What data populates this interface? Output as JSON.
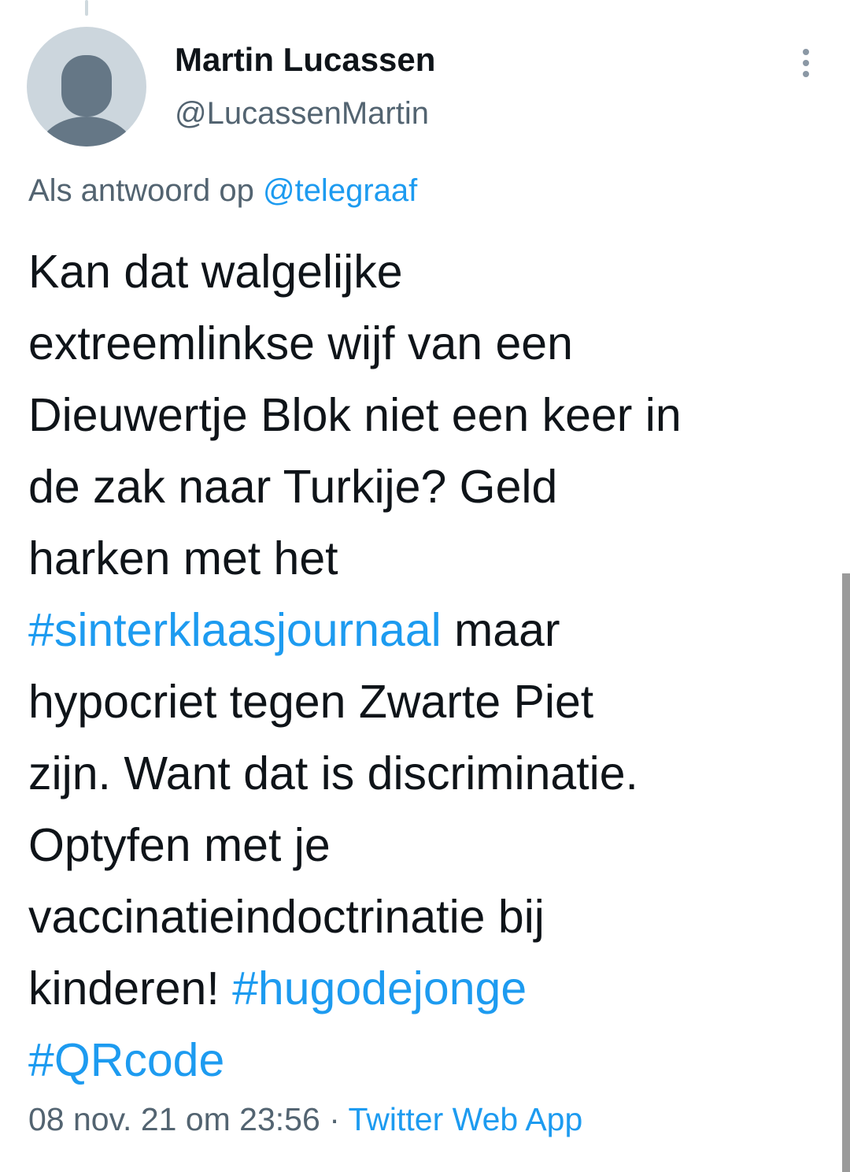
{
  "tweet": {
    "author_name": "Martin Lucassen",
    "author_handle": "@LucassenMartin",
    "avatar_icon": "default-profile-icon",
    "more_icon": "more-vertical-icon",
    "reply_prefix": "Als antwoord op",
    "reply_to_handle": "@telegraaf",
    "body_lines": [
      "Kan dat walgelijke",
      "extreemlinkse wijf van een",
      "Dieuwertje Blok niet een keer in",
      "de zak naar Turkije? Geld",
      "harken met het",
      {
        "hashtag": "#sinterklaasjournaal",
        "text": " maar"
      },
      "hypocriet tegen Zwarte Piet",
      "zijn. Want dat is discriminatie.",
      "Optyfen met je",
      "vaccinatieindoctrinatie bij",
      {
        "text": "kinderen! ",
        "hashtag": "#hugodejonge"
      },
      {
        "hashtag": "#QRcode"
      }
    ],
    "hashtags": {
      "sinterklaas": "#sinterklaasjournaal",
      "hugo": "#hugodejonge",
      "qr": "#QRcode"
    },
    "text_parts": {
      "line6_rest": " maar",
      "line11_lead": "kinderen! "
    },
    "timestamp": "08 nov. 21 om 23:56",
    "separator": " · ",
    "source_app": "Twitter Web App"
  },
  "colors": {
    "link": "#1d9bf0",
    "text": "#0f1419",
    "secondary": "#536471",
    "avatar_bg": "#ccd6dd",
    "avatar_fg": "#657786"
  }
}
